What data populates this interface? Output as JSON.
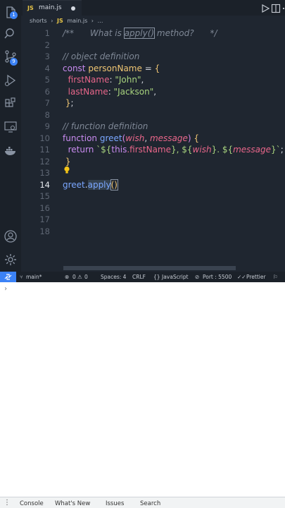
{
  "tab": {
    "icon": "JS",
    "label": "main.js"
  },
  "breadcrumb": {
    "folder": "shorts",
    "sep1": "›",
    "file_icon": "JS",
    "file": "main.js",
    "sep2": "›",
    "tail": "…"
  },
  "activity_bar": {
    "explorer_badge": "1",
    "source_control_badge": "9",
    "icons": [
      "files-icon",
      "search-icon",
      "source-control-icon",
      "run-debug-icon",
      "extensions-icon",
      "remote-explorer-icon",
      "docker-icon",
      "account-icon",
      "settings-gear-icon"
    ]
  },
  "editor": {
    "active_line": 14,
    "lines": [
      {
        "n": "1",
        "tokens": [
          {
            "t": "/**",
            "c": "c-com"
          },
          {
            "t": "      What is ",
            "c": "c-com"
          },
          {
            "t": "apply()",
            "c": "c-com boxed"
          },
          {
            "t": " method?      */",
            "c": "c-com"
          }
        ]
      },
      {
        "n": "2",
        "tokens": []
      },
      {
        "n": "3",
        "tokens": [
          {
            "t": "// object definition",
            "c": "c-com"
          }
        ]
      },
      {
        "n": "4",
        "tokens": [
          {
            "t": "const ",
            "c": "c-kw"
          },
          {
            "t": "personName",
            "c": "c-var"
          },
          {
            "t": " = ",
            "c": "c-pun"
          },
          {
            "t": "{",
            "c": "c-brk"
          }
        ]
      },
      {
        "n": "5",
        "tokens": [
          {
            "t": "  firstName",
            "c": "c-prop"
          },
          {
            "t": ": ",
            "c": "c-pun"
          },
          {
            "t": "\"John\"",
            "c": "c-str"
          },
          {
            "t": ",",
            "c": "c-pun"
          }
        ]
      },
      {
        "n": "6",
        "tokens": [
          {
            "t": "  lastName",
            "c": "c-prop"
          },
          {
            "t": ": ",
            "c": "c-pun"
          },
          {
            "t": "\"Jackson\"",
            "c": "c-str"
          },
          {
            "t": ",",
            "c": "c-pun"
          }
        ]
      },
      {
        "n": "7",
        "tokens": [
          {
            "t": " }",
            "c": "c-brk"
          },
          {
            "t": ";",
            "c": "c-pun"
          }
        ]
      },
      {
        "n": "8",
        "tokens": []
      },
      {
        "n": "9",
        "tokens": [
          {
            "t": "// function definition",
            "c": "c-com"
          }
        ]
      },
      {
        "n": "10",
        "tokens": [
          {
            "t": "function ",
            "c": "c-kw"
          },
          {
            "t": "greet",
            "c": "c-fn"
          },
          {
            "t": "(",
            "c": "c-brk2"
          },
          {
            "t": "wish",
            "c": "c-par"
          },
          {
            "t": ", ",
            "c": "c-pun"
          },
          {
            "t": "message",
            "c": "c-par"
          },
          {
            "t": ")",
            "c": "c-brk2"
          },
          {
            "t": " {",
            "c": "c-brk"
          }
        ]
      },
      {
        "n": "11",
        "tokens": [
          {
            "t": "  return ",
            "c": "c-kw"
          },
          {
            "t": "`${",
            "c": "c-str"
          },
          {
            "t": "this",
            "c": "c-kw"
          },
          {
            "t": ".firstName",
            "c": "c-prop"
          },
          {
            "t": "}, ${",
            "c": "c-str"
          },
          {
            "t": "wish",
            "c": "c-par"
          },
          {
            "t": "}. ${",
            "c": "c-str"
          },
          {
            "t": "message",
            "c": "c-par"
          },
          {
            "t": "}`",
            "c": "c-str"
          },
          {
            "t": ";",
            "c": "c-pun"
          }
        ]
      },
      {
        "n": "12",
        "tokens": [
          {
            "t": " }",
            "c": "c-brk"
          }
        ]
      },
      {
        "n": "13",
        "tokens": []
      },
      {
        "n": "14",
        "tokens": [
          {
            "t": "greet",
            "c": "c-fn"
          },
          {
            "t": ".",
            "c": "c-pun"
          },
          {
            "t": "apply",
            "c": "c-fn sel"
          },
          {
            "t": "()",
            "c": "c-brk boxed"
          }
        ]
      },
      {
        "n": "15",
        "tokens": []
      },
      {
        "n": "16",
        "tokens": []
      },
      {
        "n": "17",
        "tokens": []
      },
      {
        "n": "18",
        "tokens": []
      }
    ]
  },
  "status_bar": {
    "branch": "main*",
    "errors": "0",
    "warnings": "0",
    "spaces": "Spaces: 4",
    "eol": "CRLF",
    "language": "JavaScript",
    "port": "Port : 5500",
    "formatter": "Prettier",
    "accent_color": "#3b82f6"
  },
  "console": {
    "prompt": "›"
  },
  "drawer": {
    "menu_icon": "⋮",
    "tabs": [
      "Console",
      "What's New",
      "Issues",
      "Search"
    ]
  }
}
